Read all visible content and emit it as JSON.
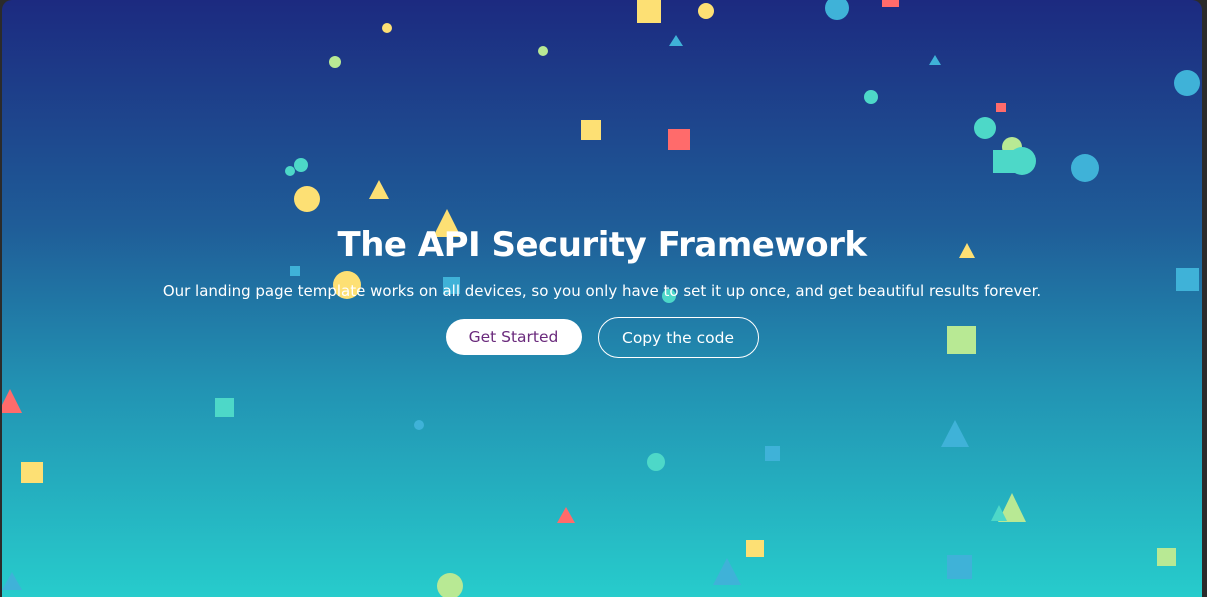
{
  "hero": {
    "title": "The API Security Framework",
    "subtitle": "Our landing page template works on all devices, so you only have to set it up once, and get beautiful results forever.",
    "primary_button": "Get Started",
    "secondary_button": "Copy the code"
  },
  "colors": {
    "gradient_top": "#1c2a80",
    "gradient_bottom": "#27cccc",
    "shape_yellow": "#fde074",
    "shape_red": "#ff6b6b",
    "shape_teal": "#4dd8c8",
    "shape_blue": "#3fb2d8",
    "shape_lime": "#b8e994",
    "primary_button_text": "#6a2a7c"
  }
}
